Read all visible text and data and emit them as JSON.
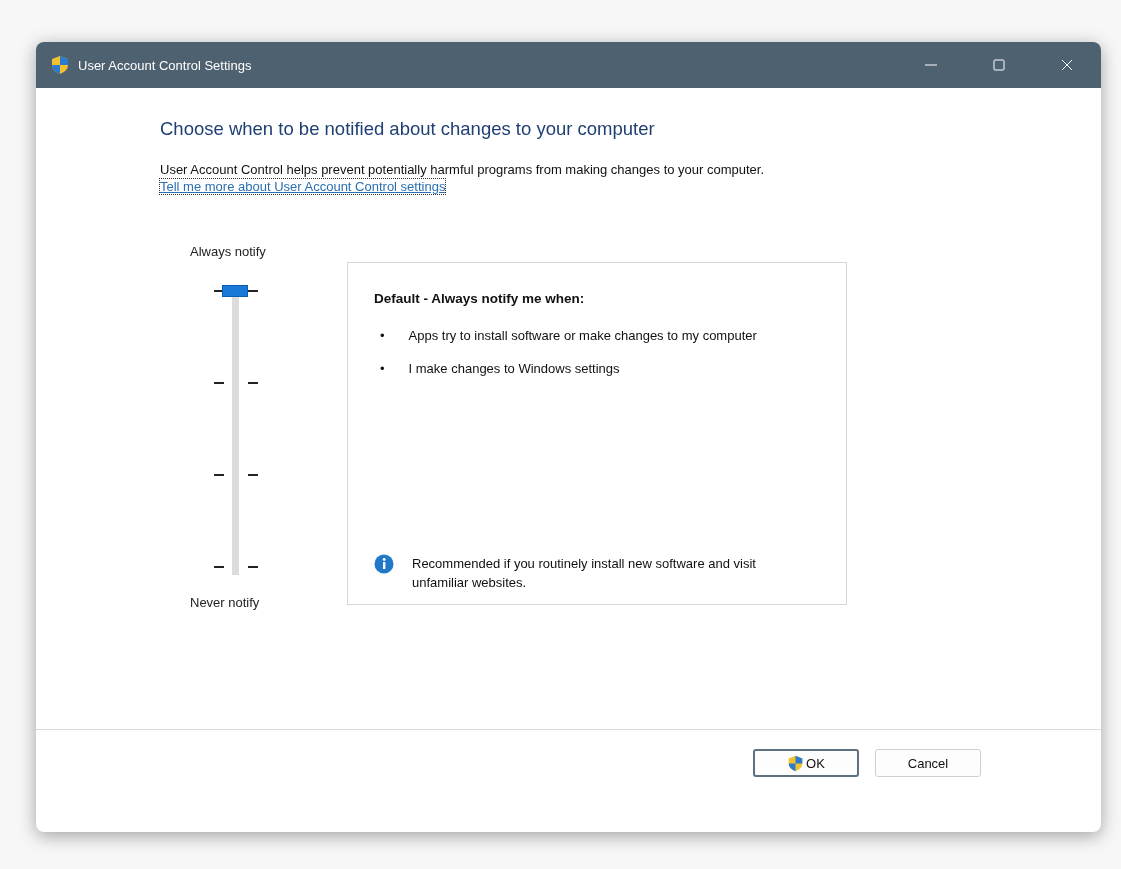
{
  "window": {
    "title": "User Account Control Settings"
  },
  "heading": "Choose when to be notified about changes to your computer",
  "description": "User Account Control helps prevent potentially harmful programs from making changes to your computer.",
  "link": "Tell me more about User Account Control settings",
  "slider": {
    "top_label": "Always notify",
    "bottom_label": "Never notify",
    "level": 1
  },
  "info": {
    "title": "Default - Always notify me when:",
    "bullets": [
      {
        "marker": "•",
        "text": "Apps try to install software or make changes to my computer"
      },
      {
        "marker": "•",
        "text": "I make changes to Windows settings"
      }
    ],
    "note": "Recommended if you routinely install new software and visit unfamiliar websites."
  },
  "buttons": [
    {
      "label": "OK",
      "kind": "shield"
    },
    {
      "label": "Cancel",
      "kind": "plain"
    }
  ]
}
